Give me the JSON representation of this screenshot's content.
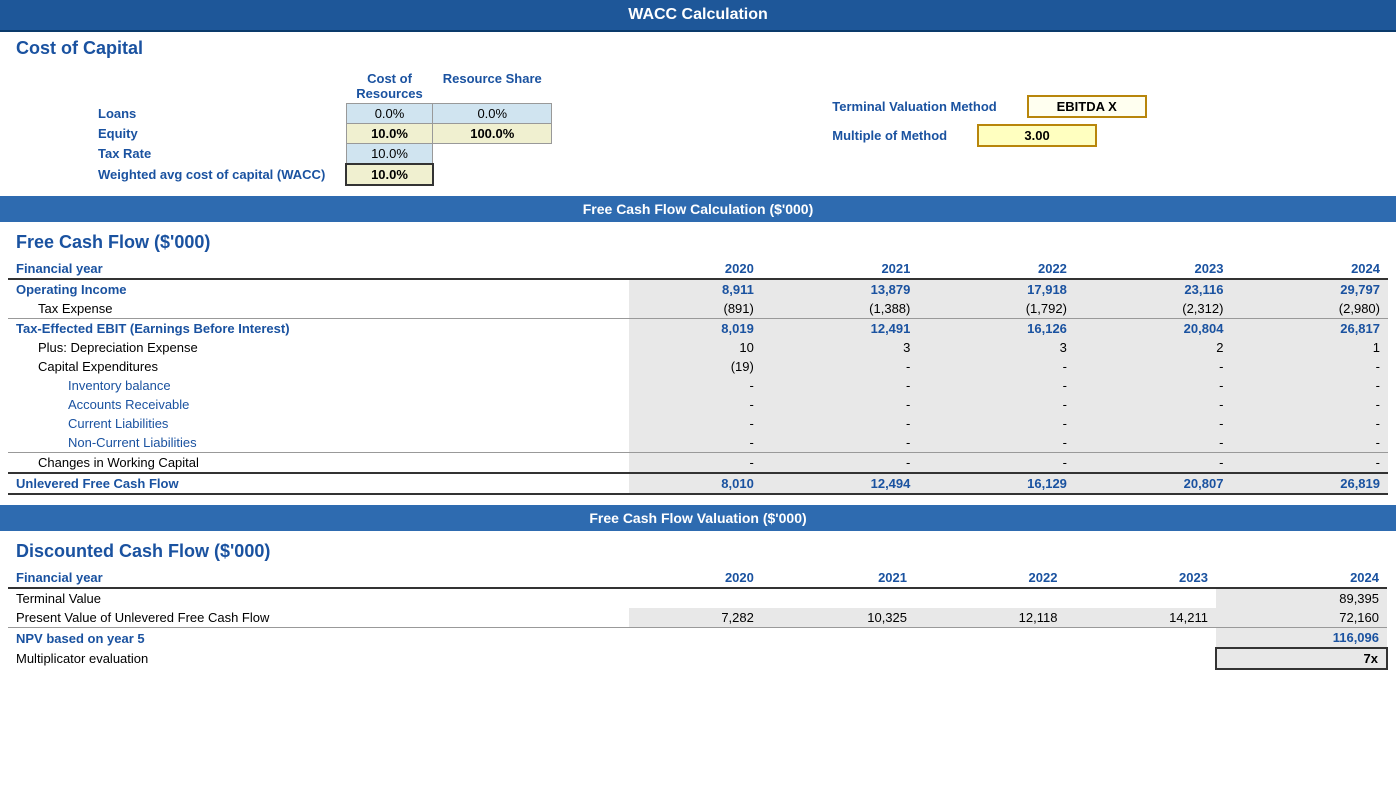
{
  "header": {
    "main_title": "WACC Calculation"
  },
  "cost_of_capital": {
    "section_label": "Cost of Capital",
    "col_cost": "Cost of",
    "col_resources": "Resources",
    "col_resource_share": "Resource Share",
    "rows": [
      {
        "label": "Loans",
        "cost": "0.0%",
        "share": "0.0%"
      },
      {
        "label": "Equity",
        "cost": "10.0%",
        "share": "100.0%"
      },
      {
        "label": "Tax Rate",
        "cost": "10.0%",
        "share": ""
      },
      {
        "label": "Weighted avg cost of capital (WACC)",
        "cost": "10.0%",
        "share": ""
      }
    ],
    "terminal_valuation_label": "Terminal Valuation Method",
    "multiple_of_method_label": "Multiple of Method",
    "terminal_value": "EBITDA X",
    "multiple_value": "3.00"
  },
  "fcf_section_title": "Free Cash Flow Calculation ($'000)",
  "fcf": {
    "section_label": "Free Cash Flow ($'000)",
    "financial_year_label": "Financial year",
    "years": [
      "2020",
      "2021",
      "2022",
      "2023",
      "2024"
    ],
    "rows": [
      {
        "label": "Operating Income",
        "type": "bold-blue",
        "values": [
          "8,911",
          "13,879",
          "17,918",
          "23,116",
          "29,797"
        ]
      },
      {
        "label": "Tax Expense",
        "type": "indent1",
        "values": [
          "(891)",
          "(1,388)",
          "(1,792)",
          "(2,312)",
          "(2,980)"
        ]
      },
      {
        "label": "Tax-Effected EBIT (Earnings Before Interest)",
        "type": "bold-blue",
        "values": [
          "8,019",
          "12,491",
          "16,126",
          "20,804",
          "26,817"
        ]
      },
      {
        "label": "Plus: Depreciation Expense",
        "type": "indent1",
        "values": [
          "10",
          "3",
          "3",
          "2",
          "1"
        ]
      },
      {
        "label": "Capital Expenditures",
        "type": "indent1",
        "values": [
          "(19)",
          "-",
          "-",
          "-",
          "-"
        ]
      },
      {
        "label": "Inventory balance",
        "type": "indent2",
        "values": [
          "-",
          "-",
          "-",
          "-",
          "-"
        ]
      },
      {
        "label": "Accounts Receivable",
        "type": "indent2",
        "values": [
          "-",
          "-",
          "-",
          "-",
          "-"
        ]
      },
      {
        "label": "Current Liabilities",
        "type": "indent2",
        "values": [
          "-",
          "-",
          "-",
          "-",
          "-"
        ]
      },
      {
        "label": "Non-Current Liabilities",
        "type": "indent2",
        "values": [
          "-",
          "-",
          "-",
          "-",
          "-"
        ]
      },
      {
        "label": "Changes in Working Capital",
        "type": "indent1-border",
        "values": [
          "-",
          "-",
          "-",
          "-",
          "-"
        ]
      },
      {
        "label": "Unlevered Free Cash Flow",
        "type": "unlevered",
        "values": [
          "8,010",
          "12,494",
          "16,129",
          "20,807",
          "26,819"
        ]
      }
    ]
  },
  "fcf_valuation_title": "Free Cash Flow Valuation ($'000)",
  "dcf": {
    "section_label": "Discounted Cash Flow ($'000)",
    "financial_year_label": "Financial year",
    "years": [
      "2020",
      "2021",
      "2022",
      "2023",
      "2024"
    ],
    "rows": [
      {
        "label": "Terminal Value",
        "type": "normal",
        "values": [
          "",
          "",
          "",
          "",
          "89,395"
        ]
      },
      {
        "label": "Present Value of Unlevered Free Cash Flow",
        "type": "normal",
        "values": [
          "7,282",
          "10,325",
          "12,118",
          "14,211",
          "72,160"
        ]
      }
    ],
    "npv_label": "NPV based on year 5",
    "npv_value": "116,096",
    "multiplicator_label": "Multiplicator evaluation",
    "multiplicator_value": "7x"
  }
}
